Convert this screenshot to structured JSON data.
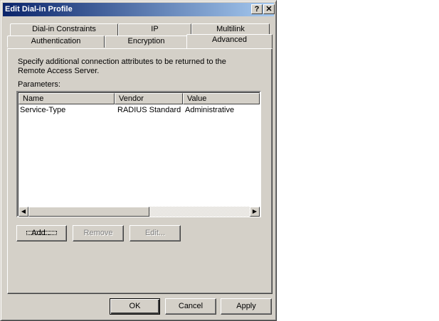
{
  "window": {
    "title": "Edit Dial-in Profile",
    "help_label": "?",
    "close_label": "✕"
  },
  "tabs": {
    "row1": [
      "Dial-in Constraints",
      "IP",
      "Multilink"
    ],
    "row2": [
      "Authentication",
      "Encryption",
      "Advanced"
    ],
    "active": "Advanced"
  },
  "advanced": {
    "description": "Specify additional connection attributes to be returned to the Remote Access Server.",
    "parameters_label": "Parameters:",
    "columns": [
      "Name",
      "Vendor",
      "Value"
    ],
    "rows": [
      {
        "name": "Service-Type",
        "vendor": "RADIUS Standard",
        "value": "Administrative"
      }
    ],
    "add_label": "Add...",
    "remove_label": "Remove",
    "edit_label": "Edit..."
  },
  "footer": {
    "ok_label": "OK",
    "cancel_label": "Cancel",
    "apply_label": "Apply"
  }
}
